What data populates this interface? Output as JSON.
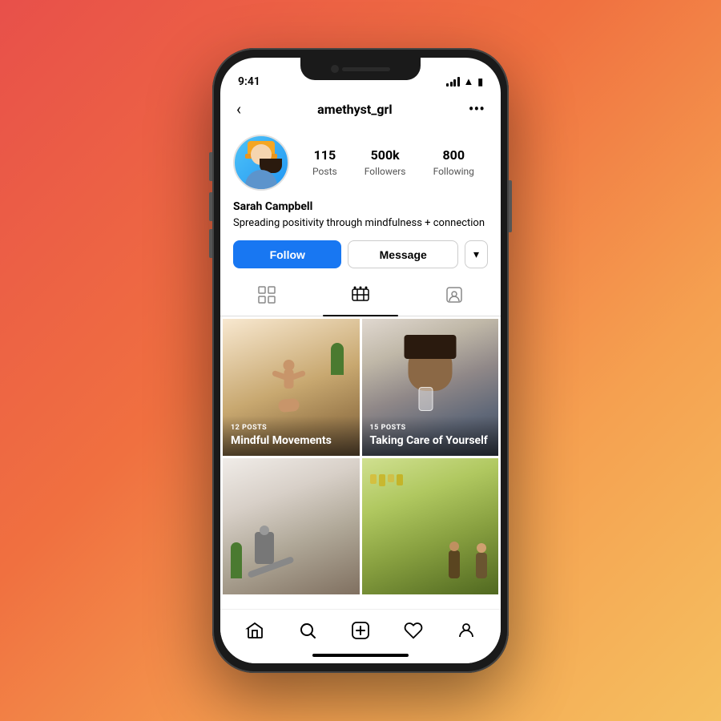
{
  "background": {
    "gradient": "linear-gradient(135deg, #e8504a 0%, #f07040 40%, #f5a050 70%, #f5c060 100%)"
  },
  "status_bar": {
    "time": "9:41",
    "signal_label": "signal",
    "wifi_label": "wifi",
    "battery_label": "battery"
  },
  "top_nav": {
    "back_label": "‹",
    "username": "amethyst_grl",
    "more_label": "•••"
  },
  "profile": {
    "name": "Sarah Campbell",
    "bio": "Spreading positivity through mindfulness + connection",
    "avatar_alt": "profile photo of Sarah Campbell with yellow hat"
  },
  "stats": [
    {
      "number": "115",
      "label": "Posts"
    },
    {
      "number": "500k",
      "label": "Followers"
    },
    {
      "number": "800",
      "label": "Following"
    }
  ],
  "buttons": {
    "follow": "Follow",
    "message": "Message",
    "dropdown": "▾"
  },
  "tabs": [
    {
      "icon": "⊞",
      "label": "grid",
      "active": false
    },
    {
      "icon": "⊟",
      "label": "reels",
      "active": true
    },
    {
      "icon": "◫",
      "label": "tagged",
      "active": false
    }
  ],
  "grid_items": [
    {
      "id": "mindful-movements",
      "posts_count": "12 POSTS",
      "title": "Mindful Movements",
      "photo_class": "photo-yoga",
      "has_figure": true
    },
    {
      "id": "taking-care",
      "posts_count": "15 POSTS",
      "title": "Taking Care of Yourself",
      "photo_class": "photo-woman",
      "has_figure": false
    },
    {
      "id": "stretch",
      "posts_count": "",
      "title": "",
      "photo_class": "photo-stretch",
      "has_figure": false
    },
    {
      "id": "nature",
      "posts_count": "",
      "title": "",
      "photo_class": "photo-nature",
      "has_figure": false
    }
  ],
  "bottom_nav": [
    {
      "icon": "⌂",
      "label": "home-nav"
    },
    {
      "icon": "⌕",
      "label": "search-nav"
    },
    {
      "icon": "⊕",
      "label": "add-nav"
    },
    {
      "icon": "♡",
      "label": "likes-nav"
    },
    {
      "icon": "◯",
      "label": "profile-nav"
    }
  ]
}
